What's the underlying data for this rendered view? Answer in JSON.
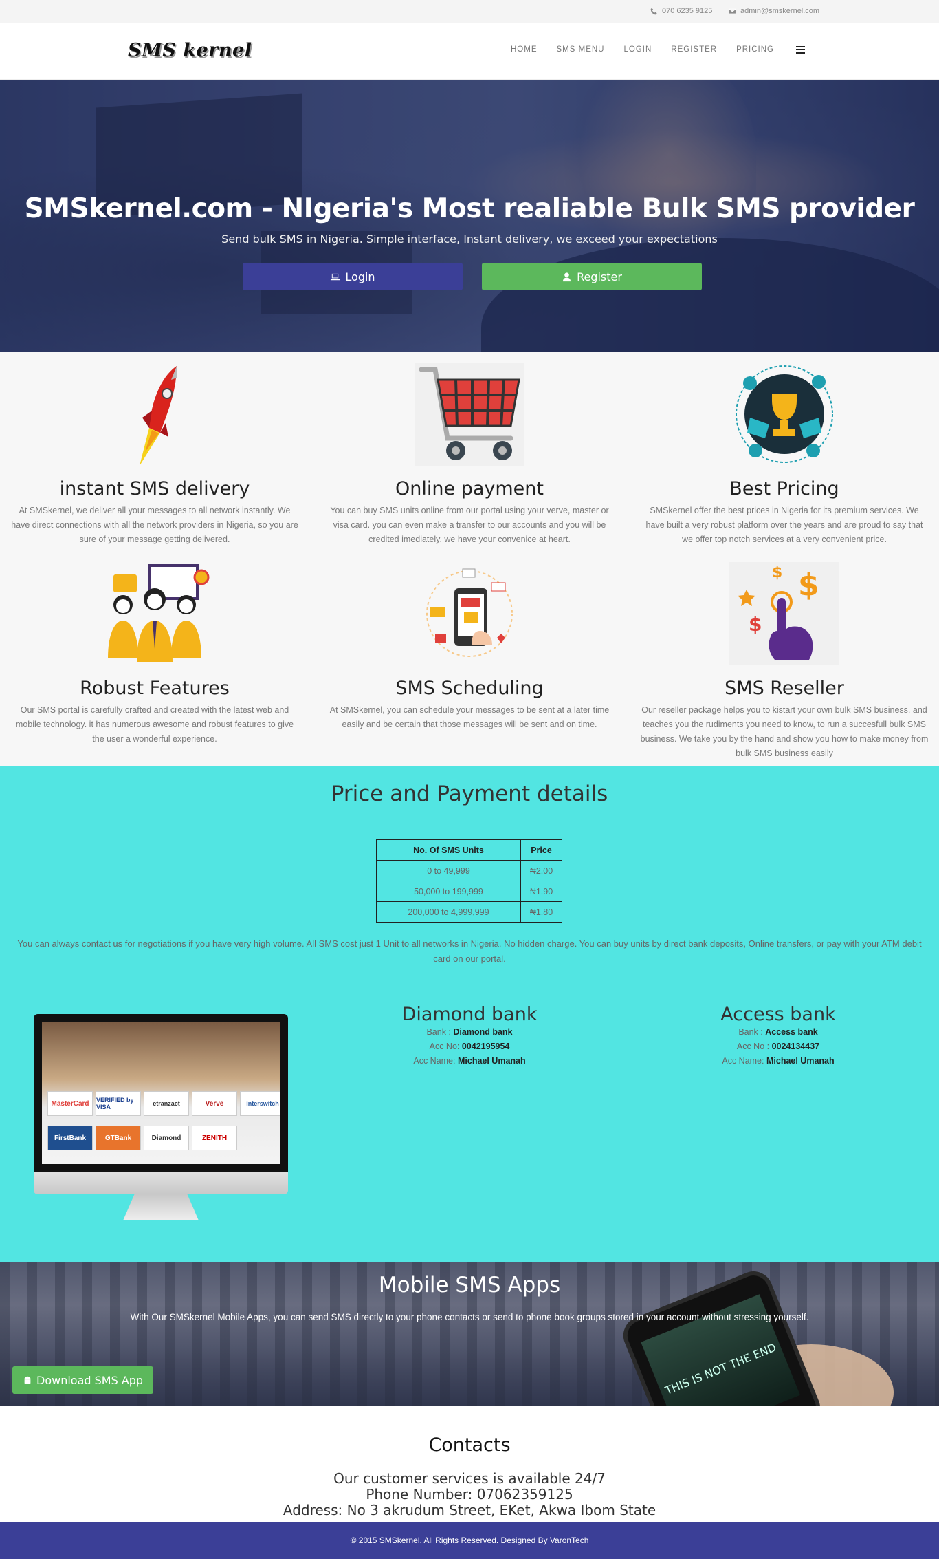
{
  "topbar": {
    "phone": "070 6235 9125",
    "email": "admin@smskernel.com",
    "phone_icon": "phone-icon",
    "email_icon": "envelope-icon"
  },
  "nav": {
    "logo": "SMS kernel",
    "links": [
      "HOME",
      "SMS MENU",
      "LOGIN",
      "REGISTER",
      "PRICING"
    ],
    "menu_icon": "hamburger-icon"
  },
  "hero": {
    "title": "SMSkernel.com - NIgeria's Most realiable Bulk SMS provider",
    "subtitle": "Send bulk SMS in Nigeria. Simple interface, Instant delivery, we exceed your expectations",
    "login_label": "Login",
    "register_label": "Register",
    "login_icon": "laptop-icon",
    "register_icon": "user-icon",
    "login_color": "#3b3f97",
    "register_color": "#5cb85c"
  },
  "features": [
    {
      "icon": "rocket-icon",
      "title": "instant SMS delivery",
      "text": "At SMSkernel, we deliver all your messages to all network instantly. We have direct connections with all the network providers in Nigeria, so you are sure of your message getting delivered."
    },
    {
      "icon": "shopping-cart-icon",
      "title": "Online payment",
      "text": "You can buy SMS units online from our portal using your verve, master or visa card. you can even make a transfer to our accounts and you will be credited imediately. we have your convenice at heart."
    },
    {
      "icon": "trophy-icon",
      "title": "Best Pricing",
      "text": "SMSkernel offer the best prices in Nigeria for its premium services. We have built a very robust platform over the years and are proud to say that we offer top notch services at a very convenient price."
    },
    {
      "icon": "team-icon",
      "title": "Robust Features",
      "text": "Our SMS portal is carefully crafted and created with the latest web and mobile technology. it has numerous awesome and robust features to give the user a wonderful experience."
    },
    {
      "icon": "mobile-shopping-icon",
      "title": "SMS Scheduling",
      "text": "At SMSkernel, you can schedule your messages to be sent at a later time easily and be certain that those messages will be sent and on time."
    },
    {
      "icon": "hand-dollar-icon",
      "title": "SMS Reseller",
      "text": "Our reseller package helps you to kistart your own bulk SMS business, and teaches you the rudiments you need to know, to run a succesfull bulk SMS business. We take you by the hand and show you how to make money from bulk SMS business easily"
    }
  ],
  "pricing": {
    "title": "Price and Payment details",
    "headers": [
      "No. Of SMS Units",
      "Price"
    ],
    "rows": [
      [
        "0 to 49,999",
        "₦2.00"
      ],
      [
        "50,000 to 199,999",
        "₦1.90"
      ],
      [
        "200,000 to 4,999,999",
        "₦1.80"
      ]
    ],
    "note": "You can always contact us for negotiations if you have very high volume. All SMS cost just 1 Unit to all networks in Nigeria. No hidden charge. You can buy units by direct bank deposits, Online transfers, or pay with your ATM debit card on our portal.",
    "background": "#52e5e2"
  },
  "payment_logos": [
    "MasterCard",
    "VERIFIED by VISA",
    "etranzact",
    "Verve",
    "interswitch",
    "FirstBank",
    "GTBank",
    "Diamond",
    "ZENITH"
  ],
  "banks": [
    {
      "name": "Diamond bank",
      "bank_label": "Bank :",
      "bank_value": "Diamond bank",
      "acc_label": "Acc No:",
      "acc_value": "0042195954",
      "name_label": "Acc Name:",
      "name_value": "Michael Umanah"
    },
    {
      "name": "Access bank",
      "bank_label": "Bank :",
      "bank_value": "Access bank",
      "acc_label": "Acc No :",
      "acc_value": "0024134437",
      "name_label": "Acc Name:",
      "name_value": "Michael Umanah"
    }
  ],
  "apps": {
    "title": "Mobile SMS Apps",
    "text": "With Our SMSkernel Mobile Apps, you can send SMS directly to your phone contacts or send to phone book groups stored in your account without stressing yourself.",
    "button": "Download SMS App",
    "button_icon": "android-icon",
    "phone_screen": "THIS IS NOT THE END"
  },
  "contacts": {
    "title": "Contacts",
    "line1": "Our customer services is available 24/7",
    "line2": "Phone Number: 07062359125",
    "line3": "Address: No 3 akrudum Street, EKet, Akwa Ibom State"
  },
  "footer": {
    "text": "© 2015 SMSkernel. All Rights Reserved. Designed By VaronTech",
    "background": "#3b3f97"
  }
}
